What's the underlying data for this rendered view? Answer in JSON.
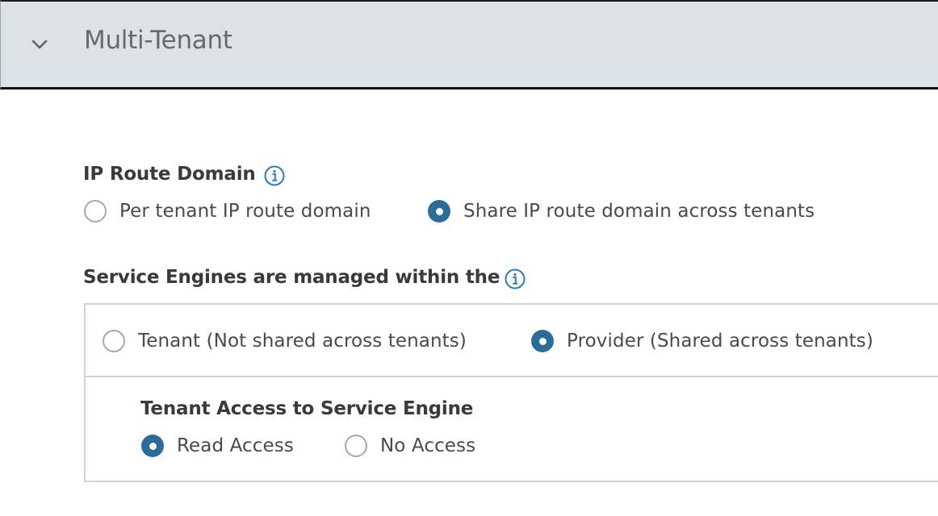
{
  "section": {
    "title": "Multi-Tenant",
    "expand_icon": "chevron-down-icon"
  },
  "ip_route_domain": {
    "label": "IP Route Domain",
    "info_icon": "info-icon",
    "options": [
      {
        "label": "Per tenant IP route domain",
        "selected": false
      },
      {
        "label": "Share IP route domain across tenants",
        "selected": true
      }
    ]
  },
  "service_engines": {
    "label": "Service Engines are managed within the",
    "info_icon": "info-icon",
    "options": [
      {
        "label": "Tenant (Not shared across tenants)",
        "selected": false
      },
      {
        "label": "Provider (Shared across tenants)",
        "selected": true
      }
    ],
    "tenant_access": {
      "label": "Tenant Access to Service Engine",
      "options": [
        {
          "label": "Read Access",
          "selected": true
        },
        {
          "label": "No Access",
          "selected": false
        }
      ]
    }
  },
  "colors": {
    "header_background": "#dbe3e8",
    "radio_selected": "#2b6d98",
    "info_icon": "#2b7bbf",
    "border": "#d3d3d3"
  }
}
